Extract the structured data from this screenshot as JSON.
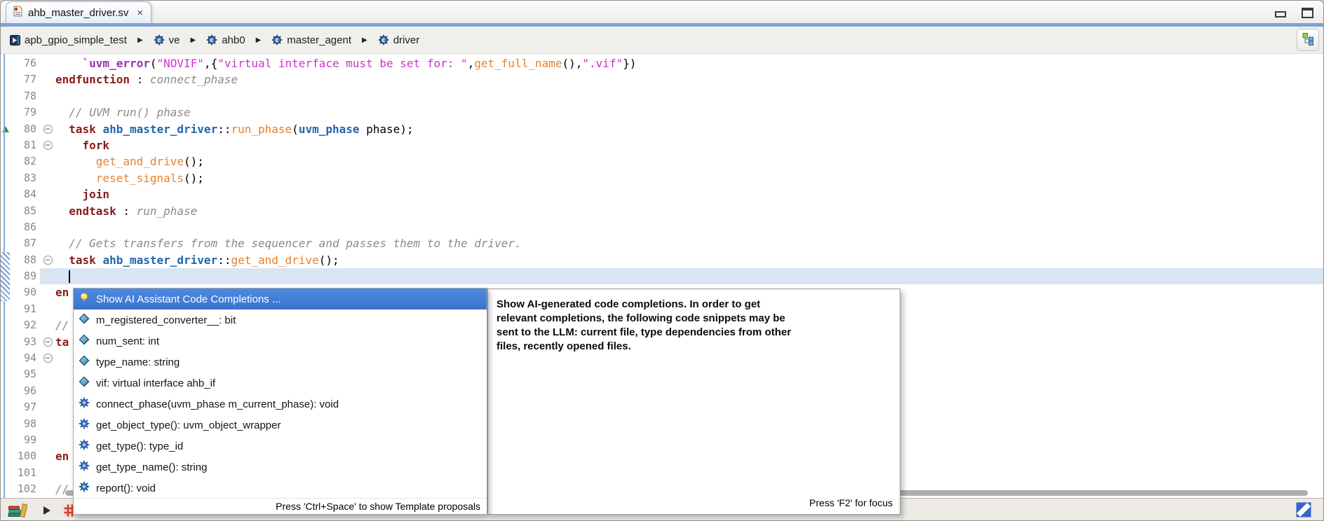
{
  "window": {
    "tab": {
      "label": "ahb_master_driver.sv",
      "close_glyph": "×"
    }
  },
  "breadcrumb": {
    "separator": "▶",
    "items": [
      {
        "label": "apb_gpio_simple_test",
        "icon": "module-icon"
      },
      {
        "label": "ve",
        "icon": "class-icon"
      },
      {
        "label": "ahb0",
        "icon": "class-icon"
      },
      {
        "label": "master_agent",
        "icon": "class-icon"
      },
      {
        "label": "driver",
        "icon": "class-icon"
      }
    ]
  },
  "editor": {
    "lines": [
      {
        "num": 76,
        "segs": [
          [
            "plain",
            "    "
          ],
          [
            "macro",
            "`uvm_error"
          ],
          [
            "plain",
            "("
          ],
          [
            "str",
            "\"NOVIF\""
          ],
          [
            "plain",
            ",{"
          ],
          [
            "str",
            "\"virtual interface must be set for: \""
          ],
          [
            "plain",
            ","
          ],
          [
            "func",
            "get_full_name"
          ],
          [
            "plain",
            "(),"
          ],
          [
            "str",
            "\".vif\""
          ],
          [
            "plain",
            "})"
          ]
        ]
      },
      {
        "num": 77,
        "segs": [
          [
            "kw",
            "endfunction"
          ],
          [
            "plain",
            " : "
          ],
          [
            "label",
            "connect_phase"
          ]
        ]
      },
      {
        "num": 78,
        "segs": []
      },
      {
        "num": 79,
        "segs": [
          [
            "plain",
            "  "
          ],
          [
            "comment",
            "// UVM run() phase"
          ]
        ]
      },
      {
        "num": 80,
        "fold": true,
        "marker": "green-triangle",
        "segs": [
          [
            "plain",
            "  "
          ],
          [
            "kw",
            "task"
          ],
          [
            "plain",
            " "
          ],
          [
            "type",
            "ahb_master_driver"
          ],
          [
            "plain",
            "::"
          ],
          [
            "func",
            "run_phase"
          ],
          [
            "plain",
            "("
          ],
          [
            "type",
            "uvm_phase"
          ],
          [
            "plain",
            " phase);"
          ]
        ]
      },
      {
        "num": 81,
        "fold": true,
        "segs": [
          [
            "plain",
            "    "
          ],
          [
            "kw",
            "fork"
          ]
        ]
      },
      {
        "num": 82,
        "segs": [
          [
            "plain",
            "      "
          ],
          [
            "func",
            "get_and_drive"
          ],
          [
            "plain",
            "();"
          ]
        ]
      },
      {
        "num": 83,
        "segs": [
          [
            "plain",
            "      "
          ],
          [
            "func",
            "reset_signals"
          ],
          [
            "plain",
            "();"
          ]
        ]
      },
      {
        "num": 84,
        "segs": [
          [
            "plain",
            "    "
          ],
          [
            "kw",
            "join"
          ]
        ]
      },
      {
        "num": 85,
        "segs": [
          [
            "plain",
            "  "
          ],
          [
            "kw",
            "endtask"
          ],
          [
            "plain",
            " : "
          ],
          [
            "label",
            "run_phase"
          ]
        ]
      },
      {
        "num": 86,
        "segs": []
      },
      {
        "num": 87,
        "segs": [
          [
            "plain",
            "  "
          ],
          [
            "comment",
            "// Gets transfers from the sequencer and passes them to the driver."
          ]
        ]
      },
      {
        "num": 88,
        "fold": true,
        "segs": [
          [
            "plain",
            "  "
          ],
          [
            "kw",
            "task"
          ],
          [
            "plain",
            " "
          ],
          [
            "type",
            "ahb_master_driver"
          ],
          [
            "plain",
            "::"
          ],
          [
            "func",
            "get_and_drive"
          ],
          [
            "plain",
            "();"
          ]
        ]
      },
      {
        "num": 89,
        "caret": true,
        "hl": true,
        "segs": [
          [
            "plain",
            "  "
          ]
        ]
      },
      {
        "num": 90,
        "segs": [
          [
            "kw",
            "en"
          ]
        ]
      },
      {
        "num": 91,
        "segs": []
      },
      {
        "num": 92,
        "segs": [
          [
            "comment",
            "//"
          ]
        ]
      },
      {
        "num": 93,
        "fold": true,
        "segs": [
          [
            "kw",
            "ta"
          ]
        ]
      },
      {
        "num": 94,
        "fold": true,
        "segs": []
      },
      {
        "num": 95,
        "segs": []
      },
      {
        "num": 96,
        "segs": []
      },
      {
        "num": 97,
        "segs": []
      },
      {
        "num": 98,
        "segs": []
      },
      {
        "num": 99,
        "segs": []
      },
      {
        "num": 100,
        "segs": [
          [
            "kw",
            "en"
          ]
        ]
      },
      {
        "num": 101,
        "segs": []
      },
      {
        "num": 102,
        "segs": [
          [
            "comment",
            "//"
          ]
        ]
      }
    ]
  },
  "completion_popup": {
    "items": [
      {
        "icon": "lightbulb-icon",
        "label": "Show AI Assistant Code Completions ...",
        "selected": true
      },
      {
        "icon": "field-icon",
        "label": "m_registered_converter__: bit"
      },
      {
        "icon": "field-icon",
        "label": "num_sent: int"
      },
      {
        "icon": "field-icon",
        "label": "type_name: string"
      },
      {
        "icon": "field-icon",
        "label": "vif: virtual interface ahb_if"
      },
      {
        "icon": "method-icon",
        "label": "connect_phase(uvm_phase m_current_phase): void"
      },
      {
        "icon": "method-icon",
        "label": "get_object_type(): uvm_object_wrapper"
      },
      {
        "icon": "method-icon",
        "label": "get_type(): type_id"
      },
      {
        "icon": "method-icon",
        "label": "get_type_name(): string"
      },
      {
        "icon": "method-icon",
        "label": "report(): void"
      }
    ],
    "footer": "Press 'Ctrl+Space' to show Template proposals"
  },
  "ai_tooltip": {
    "lines": [
      "Show AI-generated code completions. In order to get",
      "relevant completions, the following code snippets may be",
      "sent to the LLM: current file, type dependencies from other",
      "files, recently opened files."
    ],
    "footer": "Press 'F2' for focus"
  },
  "colors": {
    "accent_band": "#7ca3d6",
    "selection_blue": "#3f78d1",
    "keyword": "#8b1a1a",
    "type": "#2166ac",
    "function": "#e5822d",
    "string": "#cc33cc",
    "macro": "#9b30b5",
    "comment": "#8a8a8a",
    "current_line": "#d9e5f3"
  }
}
